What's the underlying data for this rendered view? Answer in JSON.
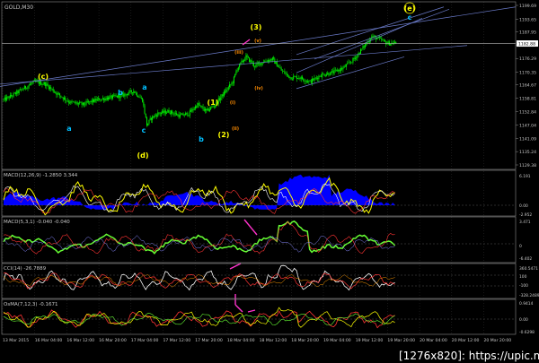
{
  "symbol_title": "GOLD,M30",
  "watermark": "[1276x820]: https://upic.me/",
  "colors": {
    "background": "#000000",
    "bull": "#00ee00",
    "bear": "#00ee00",
    "trendline": "#6a7ac8",
    "macd_fill": "#0000ff",
    "series_yellow": "#ffff00",
    "series_green": "#66ff33",
    "series_red": "#ff3333",
    "series_pink": "#ff33cc",
    "series_white": "#ffffff",
    "grid": "#303030",
    "axis_text": "#c8c8c8"
  },
  "panels": {
    "main": {
      "y_ticks": [
        "1199.69",
        "1193.65",
        "1187.95",
        "1182.25",
        "1176.29",
        "1170.35",
        "1164.67",
        "1158.81",
        "1152.84",
        "1147.04",
        "1141.09",
        "1135.24",
        "1129.38"
      ],
      "current_price_label": "1182.88",
      "wave_labels": [
        {
          "text": "(c)",
          "color": "#ffff00"
        },
        {
          "text": "a",
          "color": "#00bfff"
        },
        {
          "text": "b",
          "color": "#00bfff"
        },
        {
          "text": "a",
          "color": "#00bfff"
        },
        {
          "text": "c",
          "color": "#00bfff"
        },
        {
          "text": "(d)",
          "color": "#ffff00"
        },
        {
          "text": "b",
          "color": "#00bfff"
        },
        {
          "text": "(1)",
          "color": "#ffff00"
        },
        {
          "text": "(2)",
          "color": "#ffff00"
        },
        {
          "text": "(3)",
          "color": "#ffff00"
        },
        {
          "text": "(iii)",
          "color": "#ff8c00"
        },
        {
          "text": "(v)",
          "color": "#ff8c00"
        },
        {
          "text": "(iv)",
          "color": "#ff8c00"
        },
        {
          "text": "(ii)",
          "color": "#ff8c00"
        },
        {
          "text": "(i)",
          "color": "#ff8c00"
        },
        {
          "text": "(e)",
          "color": "#ffff00"
        },
        {
          "text": "c",
          "color": "#00bfff"
        }
      ]
    },
    "macd1": {
      "title": "MACD(12,26,9) -1.2850 3.344",
      "y_ticks": [
        "6.191",
        "0.00",
        "-2.952"
      ]
    },
    "macd2": {
      "title": "MACD(5,3,1) -0.040 -0.040",
      "y_ticks": [
        "3.471",
        "0",
        "-6.402"
      ]
    },
    "cci": {
      "title": "CCI(14) -26.7889",
      "y_ticks": [
        "360.5471",
        "100",
        "-100",
        "-328.2489"
      ]
    },
    "osma": {
      "title": "OsMA(7,12,3) -0.1671",
      "y_ticks": [
        "0.9414",
        "0.00",
        "-0.6298"
      ]
    }
  },
  "time_axis": [
    "13 Mar 2015",
    "16 Mar 04:00",
    "16 Mar 12:00",
    "16 Mar 20:00",
    "17 Mar 04:00",
    "17 Mar 12:00",
    "17 Mar 20:00",
    "18 Mar 04:00",
    "18 Mar 12:00",
    "18 Mar 20:00",
    "19 Mar 04:00",
    "19 Mar 12:00",
    "19 Mar 20:00",
    "20 Mar 04:00",
    "20 Mar 12:00",
    "20 Mar 20:00"
  ],
  "chart_data": {
    "type": "candlestick",
    "title": "GOLD,M30",
    "ylim": [
      1129.38,
      1199.69
    ],
    "y_ticks": [
      1199.69,
      1193.65,
      1187.95,
      1182.25,
      1176.29,
      1170.35,
      1164.67,
      1158.81,
      1152.84,
      1147.04,
      1141.09,
      1135.24,
      1129.38
    ],
    "current_price": 1182.88,
    "close_path_anchors": [
      [
        0,
        1158
      ],
      [
        8,
        1160
      ],
      [
        18,
        1163
      ],
      [
        28,
        1166
      ],
      [
        38,
        1165
      ],
      [
        48,
        1161
      ],
      [
        60,
        1157
      ],
      [
        72,
        1156
      ],
      [
        84,
        1158
      ],
      [
        96,
        1159
      ],
      [
        108,
        1160
      ],
      [
        118,
        1162
      ],
      [
        126,
        1158
      ],
      [
        130,
        1147
      ],
      [
        134,
        1150
      ],
      [
        140,
        1152
      ],
      [
        150,
        1153
      ],
      [
        160,
        1151
      ],
      [
        168,
        1152
      ],
      [
        176,
        1156
      ],
      [
        184,
        1153
      ],
      [
        192,
        1156
      ],
      [
        200,
        1161
      ],
      [
        208,
        1166
      ],
      [
        212,
        1172
      ],
      [
        220,
        1177
      ],
      [
        228,
        1173
      ],
      [
        236,
        1175
      ],
      [
        244,
        1176
      ],
      [
        252,
        1171
      ],
      [
        260,
        1168
      ],
      [
        268,
        1168
      ],
      [
        278,
        1166
      ],
      [
        288,
        1169
      ],
      [
        298,
        1170
      ],
      [
        308,
        1172
      ],
      [
        318,
        1176
      ],
      [
        326,
        1181
      ],
      [
        334,
        1186
      ],
      [
        340,
        1185
      ],
      [
        348,
        1183
      ],
      [
        356,
        1183
      ]
    ]
  }
}
